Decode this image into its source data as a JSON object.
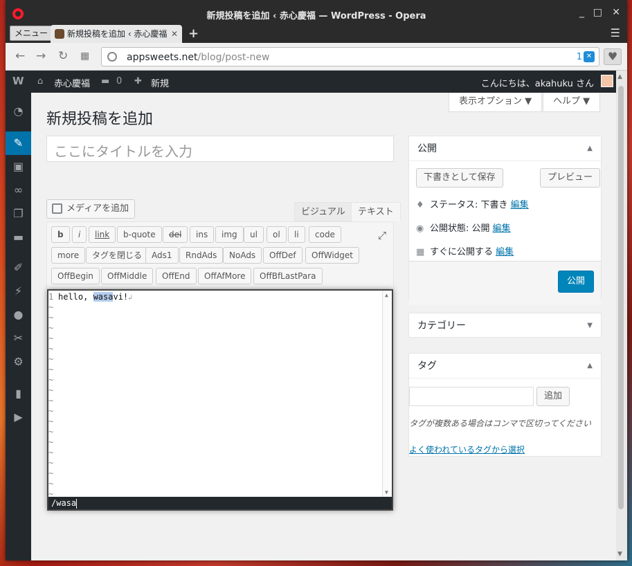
{
  "window": {
    "title": "新規投稿を追加 ‹ 赤心慶福 — WordPress - Opera",
    "controls": [
      "_",
      "□",
      "✕"
    ]
  },
  "browser": {
    "menu_label": "メニュー",
    "tab_title": "新規投稿を追加 ‹ 赤心慶福",
    "tab_close": "✕",
    "new_tab": "+",
    "url_host": "appsweets.net",
    "url_path": "/blog/post-new",
    "shield_count": "1"
  },
  "adminbar": {
    "wp_logo": "W",
    "site_name": "赤心慶福",
    "comments": "0",
    "new_label": "新規",
    "greeting": "こんにちは、akahuku さん"
  },
  "sidebar": {
    "items": [
      "dashboard-icon",
      "posts-icon",
      "media-icon",
      "links-icon",
      "pages-icon",
      "comments-icon",
      "appearance-icon",
      "plugins-icon",
      "users-icon",
      "tools-icon",
      "settings-icon",
      "stats-icon",
      "play-icon"
    ]
  },
  "screen": {
    "options_label": "表示オプション ▼",
    "help_label": "ヘルプ ▼"
  },
  "page": {
    "heading": "新規投稿を追加",
    "title_placeholder": "ここにタイトルを入力"
  },
  "editor": {
    "add_media": "メディアを追加",
    "tab_visual": "ビジュアル",
    "tab_text": "テキスト",
    "quicktags": [
      "b",
      "i",
      "link",
      "b-quote",
      "del",
      "ins",
      "img",
      "ul",
      "ol",
      "li",
      "code",
      "more",
      "タグを閉じる",
      "Ads1",
      "RndAds",
      "NoAds",
      "OffDef",
      "OffWidget",
      "OffBegin",
      "OffMiddle",
      "OffEnd",
      "OffAfMore",
      "OffBfLastPara"
    ],
    "line_number": "1",
    "text_before": "hello, ",
    "text_highlight": "wasa",
    "text_after": "vi!",
    "eol": "↲",
    "tilde": "~",
    "command_line": "/wasa"
  },
  "publish": {
    "title": "公開",
    "save_draft": "下書きとして保存",
    "preview": "プレビュー",
    "status_label": "ステータス: 下書き",
    "visibility_label": "公開状態: 公開",
    "schedule_label": "すぐに公開する",
    "edit": "編集",
    "publish_button": "公開"
  },
  "category": {
    "title": "カテゴリー"
  },
  "tags": {
    "title": "タグ",
    "add_button": "追加",
    "hint": "タグが複数ある場合はコンマで区切ってください",
    "popular_link": "よく使われているタグから選択"
  },
  "colors": {
    "accent": "#0073aa",
    "adminbar": "#23282d",
    "publish": "#0085ba",
    "highlight": "#b4cdef"
  }
}
